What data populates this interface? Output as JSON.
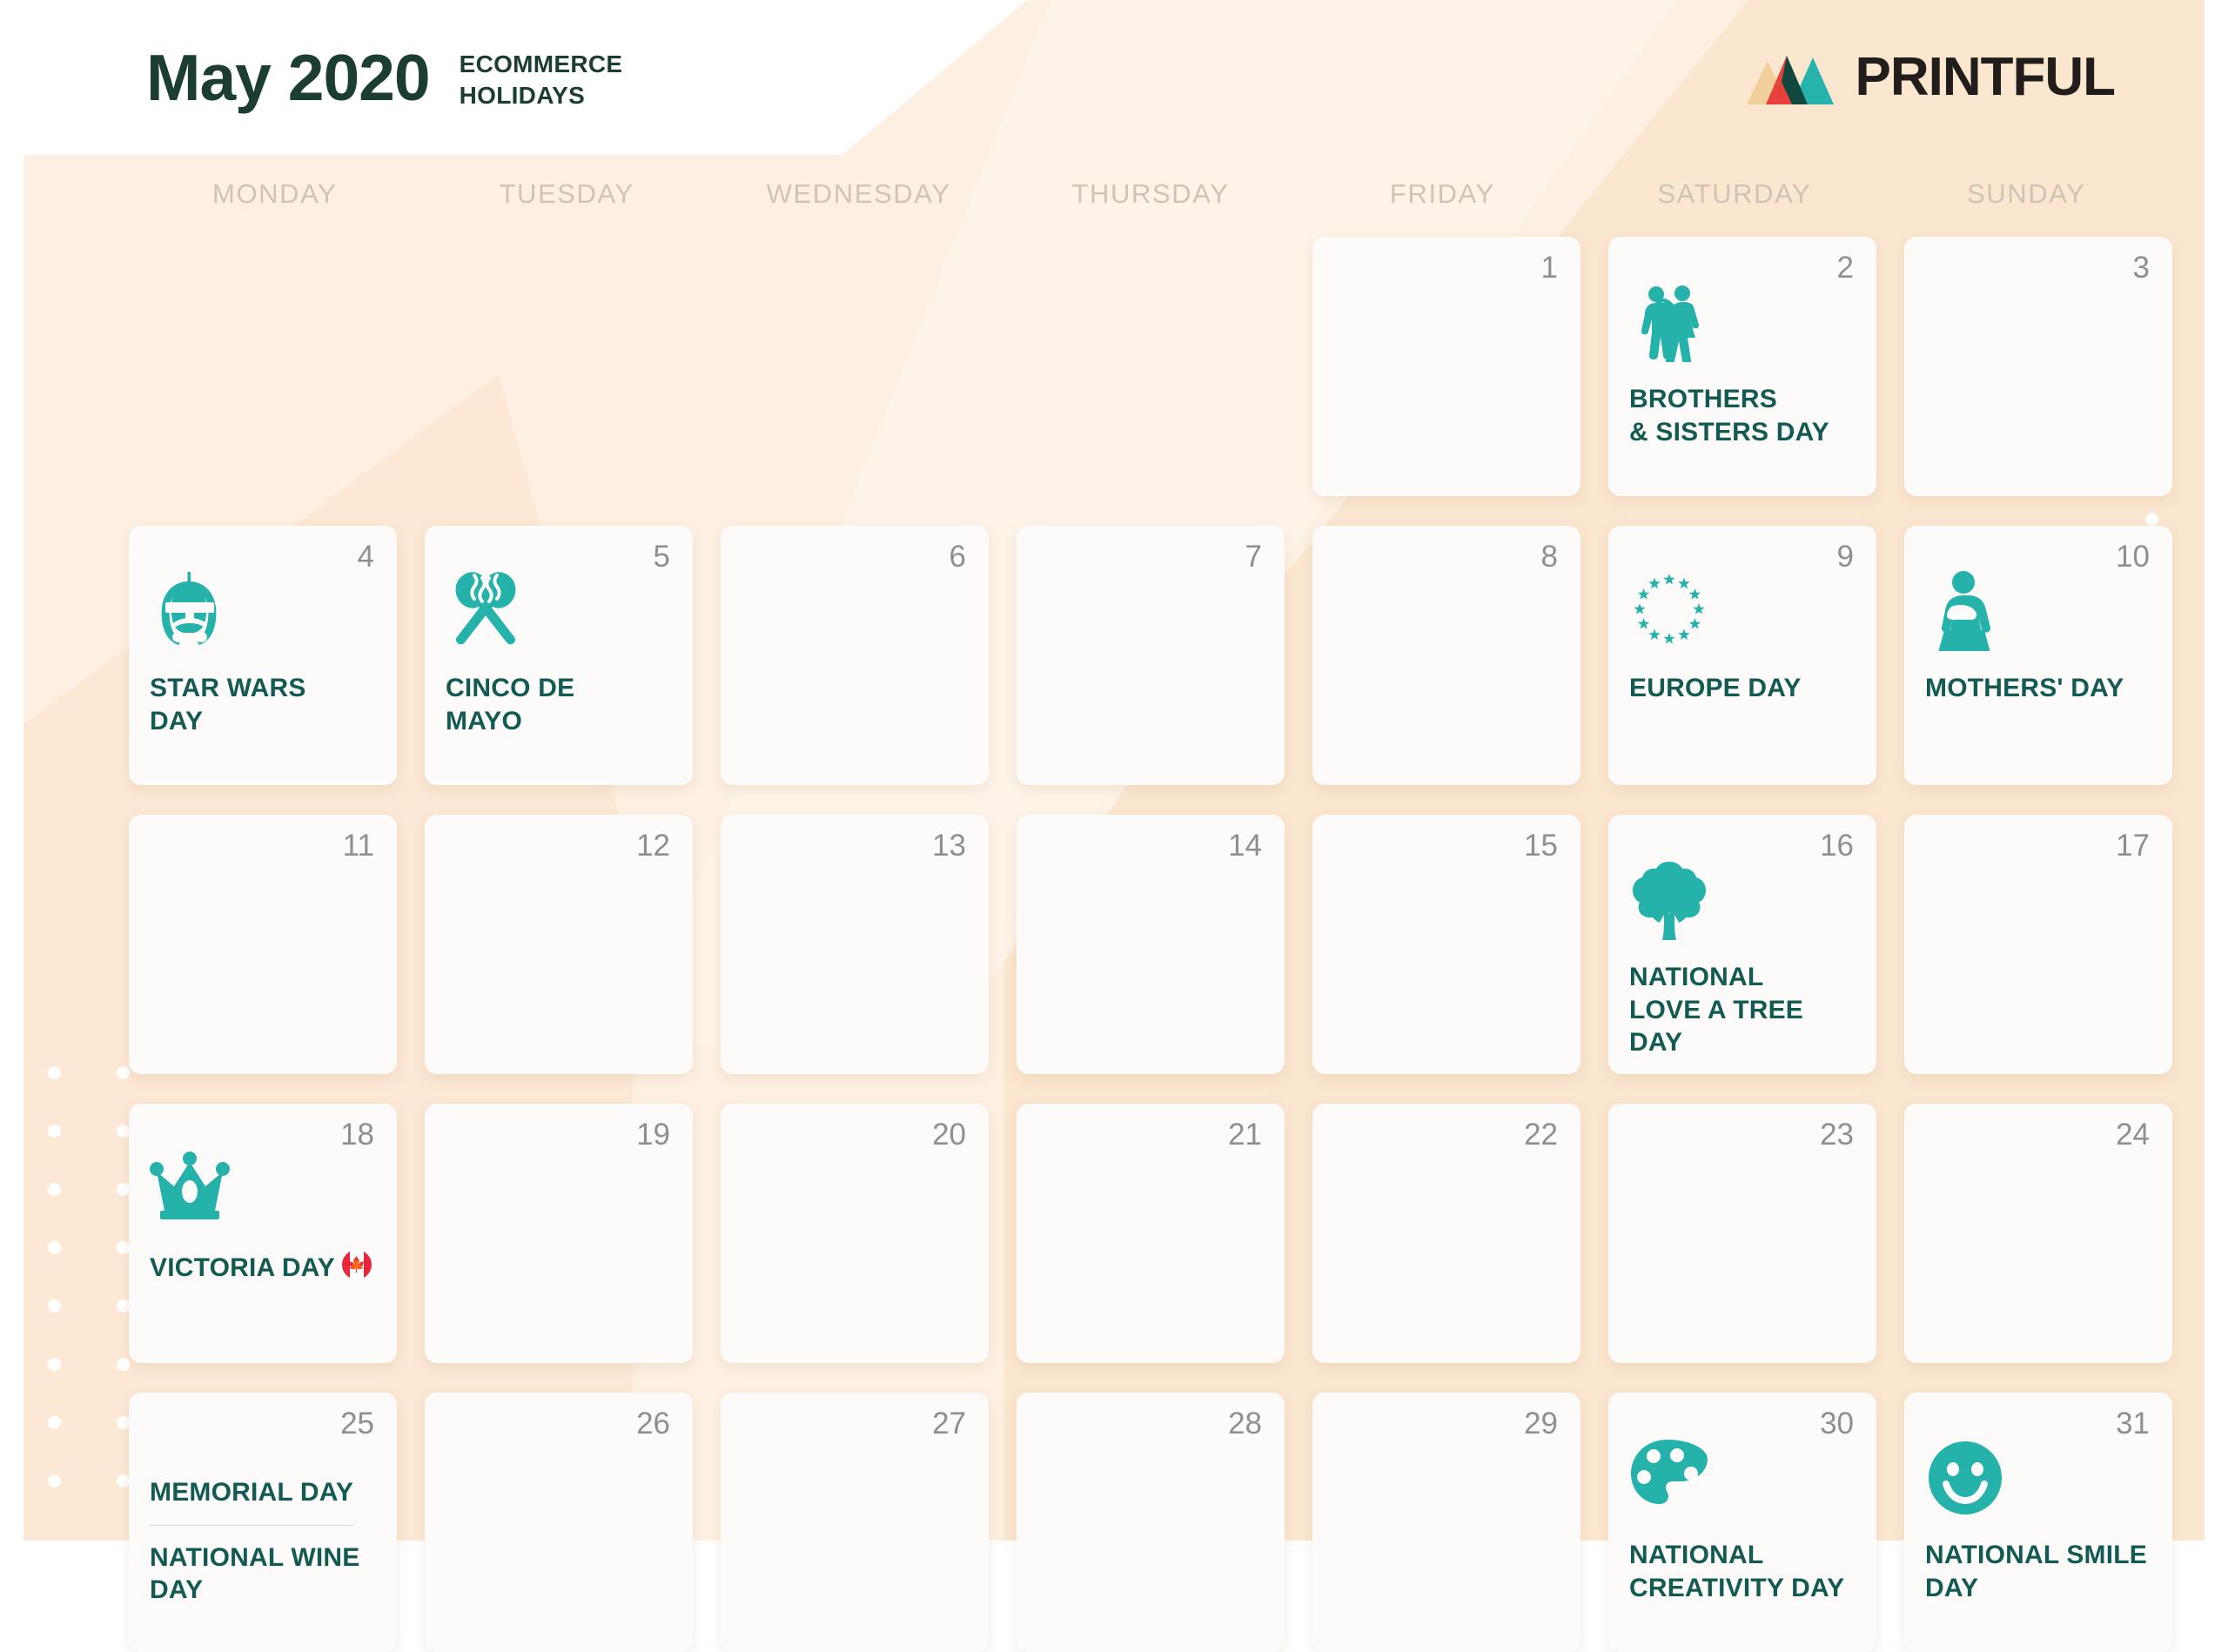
{
  "header": {
    "title": "May 2020",
    "subtitle": "ECOMMERCE\nHOLIDAYS",
    "brand_name": "PRINTFUL",
    "brand_icon": "printful-mountains-logo",
    "colors": {
      "title": "#1c3d34",
      "brand_tan": "#f2cf9a",
      "brand_red": "#e8413c",
      "brand_teal": "#26b3ac",
      "brand_dark": "#104840"
    }
  },
  "theme": {
    "background_peach": "#fdf0e2",
    "background_peach_deep": "#fbe6d0",
    "cell_background": "#fdfbfa",
    "event_text": "#135b52",
    "day_number": "#8d918b",
    "weekday_header": "#cfc3b6",
    "icon_teal": "#24b2aa"
  },
  "weekdays": [
    "MONDAY",
    "TUESDAY",
    "WEDNESDAY",
    "THURSDAY",
    "FRIDAY",
    "SATURDAY",
    "SUNDAY"
  ],
  "calendar": {
    "month": "May",
    "year": "2020",
    "leading_blanks": 4,
    "days": [
      {
        "number": "1",
        "icon": null,
        "events": []
      },
      {
        "number": "2",
        "icon": "brothers-sisters-icon",
        "events": [
          {
            "label": "BROTHERS\n& SISTERS DAY"
          }
        ]
      },
      {
        "number": "3",
        "icon": null,
        "events": []
      },
      {
        "number": "4",
        "icon": "stormtrooper-helmet-icon",
        "events": [
          {
            "label": "STAR WARS\nDAY"
          }
        ]
      },
      {
        "number": "5",
        "icon": "maracas-icon",
        "events": [
          {
            "label": "CINCO DE\nMAYO"
          }
        ]
      },
      {
        "number": "6",
        "icon": null,
        "events": []
      },
      {
        "number": "7",
        "icon": null,
        "events": []
      },
      {
        "number": "8",
        "icon": null,
        "events": []
      },
      {
        "number": "9",
        "icon": "eu-stars-icon",
        "events": [
          {
            "label": "EUROPE DAY"
          }
        ]
      },
      {
        "number": "10",
        "icon": "mother-baby-icon",
        "events": [
          {
            "label": "MOTHERS' DAY"
          }
        ]
      },
      {
        "number": "11",
        "icon": null,
        "events": []
      },
      {
        "number": "12",
        "icon": null,
        "events": []
      },
      {
        "number": "13",
        "icon": null,
        "events": []
      },
      {
        "number": "14",
        "icon": null,
        "events": []
      },
      {
        "number": "15",
        "icon": null,
        "events": []
      },
      {
        "number": "16",
        "icon": "tree-icon",
        "events": [
          {
            "label": "NATIONAL\nLOVE A TREE DAY"
          }
        ]
      },
      {
        "number": "17",
        "icon": null,
        "events": []
      },
      {
        "number": "18",
        "icon": "crown-icon",
        "events": [
          {
            "label": "VICTORIA DAY",
            "flag": "canada-flag"
          }
        ]
      },
      {
        "number": "19",
        "icon": null,
        "events": []
      },
      {
        "number": "20",
        "icon": null,
        "events": []
      },
      {
        "number": "21",
        "icon": null,
        "events": []
      },
      {
        "number": "22",
        "icon": null,
        "events": []
      },
      {
        "number": "23",
        "icon": null,
        "events": []
      },
      {
        "number": "24",
        "icon": null,
        "events": []
      },
      {
        "number": "25",
        "icon": null,
        "events": [
          {
            "label": "MEMORIAL DAY"
          },
          {
            "label": "NATIONAL WINE\nDAY"
          }
        ]
      },
      {
        "number": "26",
        "icon": null,
        "events": []
      },
      {
        "number": "27",
        "icon": null,
        "events": []
      },
      {
        "number": "28",
        "icon": null,
        "events": []
      },
      {
        "number": "29",
        "icon": null,
        "events": []
      },
      {
        "number": "30",
        "icon": "palette-icon",
        "events": [
          {
            "label": "NATIONAL\nCREATIVITY DAY"
          }
        ]
      },
      {
        "number": "31",
        "icon": "smiley-icon",
        "events": [
          {
            "label": "NATIONAL SMILE\nDAY"
          }
        ]
      }
    ]
  }
}
